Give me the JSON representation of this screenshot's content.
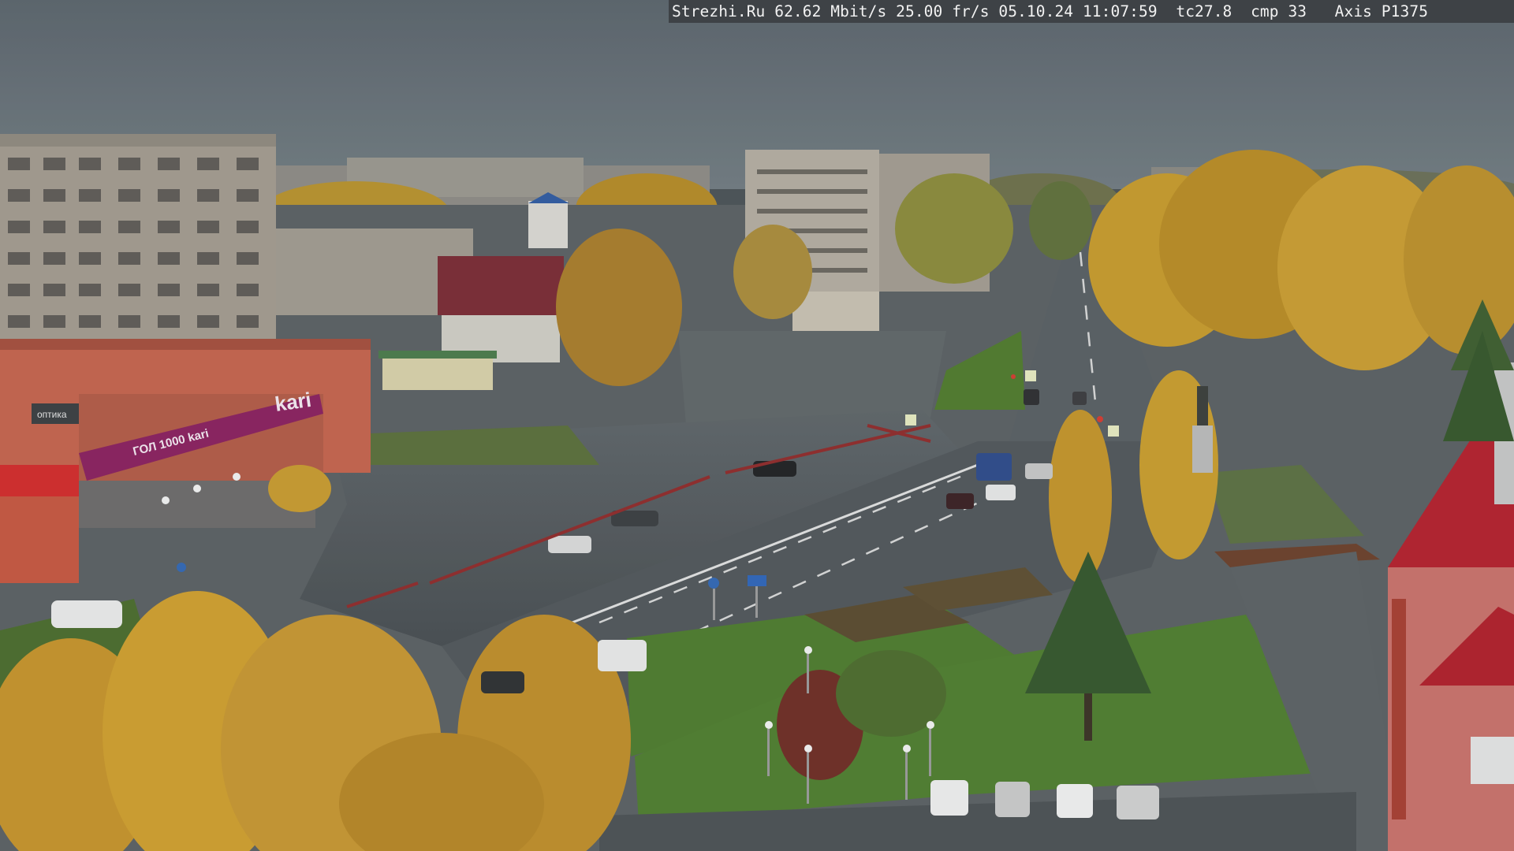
{
  "overlay": {
    "text": "Strezhi.Ru 62.62 Mbit/s 25.00 fr/s 05.10.24 11:07:59  tc27.8  cmp 33   Axis P1375"
  },
  "signs": {
    "store_main": "kari",
    "store_banner": "ГОЛ 1000 kari",
    "store_small": "оптика"
  },
  "palette": {
    "sky": "#59636b",
    "asphalt": "#4f5559",
    "grass": "#4e7a2e",
    "foliage": "#c79a27",
    "store_facade": "#c4624c",
    "store_banner": "#8a1f5e",
    "roof_red": "#b31f2c"
  },
  "icons": [
    "street-lamp-icon",
    "road-sign-icon",
    "crosswalk-sign-icon",
    "traffic-light-icon"
  ]
}
